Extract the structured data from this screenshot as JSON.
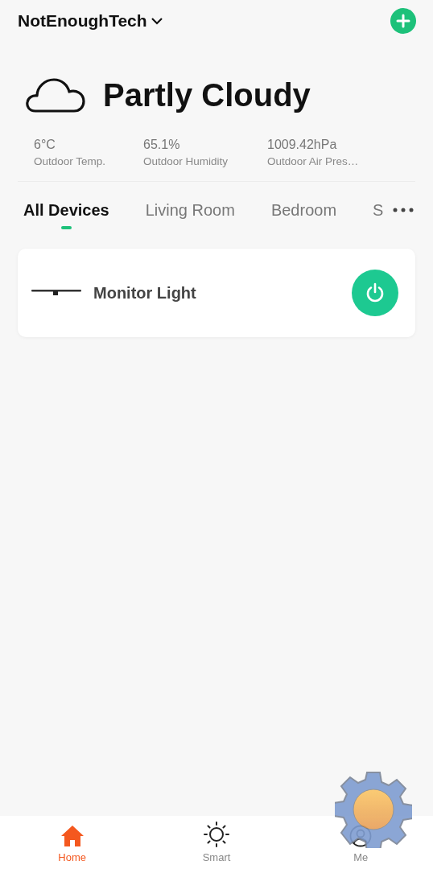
{
  "header": {
    "home_name": "NotEnoughTech"
  },
  "weather": {
    "condition": "Partly Cloudy",
    "stats": [
      {
        "value": "6°C",
        "label": "Outdoor Temp."
      },
      {
        "value": "65.1%",
        "label": "Outdoor Humidity"
      },
      {
        "value": "1009.42hPa",
        "label": "Outdoor Air Pres…"
      }
    ]
  },
  "tabs": [
    {
      "label": "All Devices",
      "selected": true
    },
    {
      "label": "Living Room",
      "selected": false
    },
    {
      "label": "Bedroom",
      "selected": false
    },
    {
      "label": "S",
      "selected": false
    }
  ],
  "devices": [
    {
      "name": "Monitor Light",
      "on": true
    }
  ],
  "bottom_nav": [
    {
      "label": "Home",
      "kind": "home",
      "selected": true
    },
    {
      "label": "Smart",
      "kind": "smart",
      "selected": false
    },
    {
      "label": "Me",
      "kind": "me",
      "selected": false
    }
  ]
}
